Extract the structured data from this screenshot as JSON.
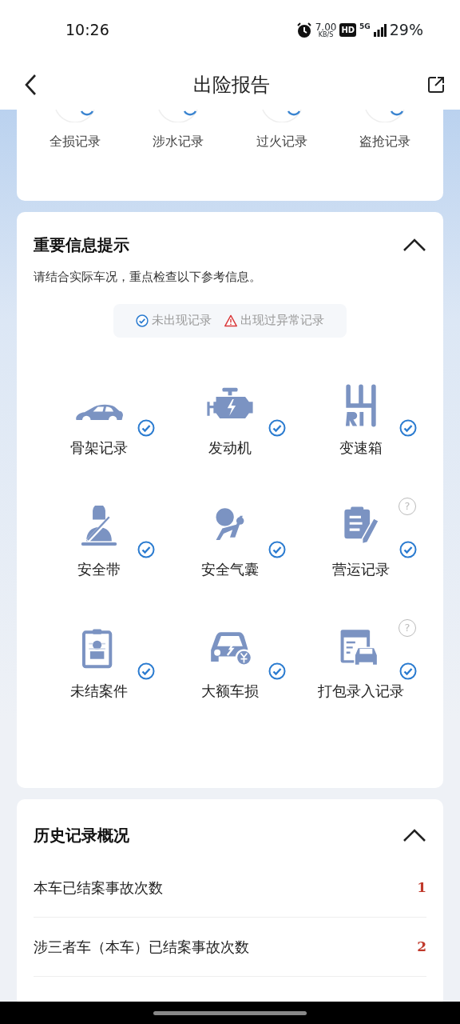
{
  "status_bar": {
    "time": "10:26",
    "net_speed": "7.00",
    "net_unit": "KB/S",
    "hd": "HD",
    "network": "5G",
    "battery": "29%"
  },
  "header": {
    "title": "出险报告"
  },
  "record_card": {
    "items": [
      {
        "label": "全损记录"
      },
      {
        "label": "涉水记录"
      },
      {
        "label": "过火记录"
      },
      {
        "label": "盗抢记录"
      }
    ]
  },
  "info_card": {
    "title": "重要信息提示",
    "expanded": true,
    "subtitle": "请结合实际车况，重点检查以下参考信息。",
    "legend": [
      {
        "kind": "ok",
        "label": "未出现记录"
      },
      {
        "kind": "abnormal",
        "label": "出现过异常记录"
      }
    ],
    "items": [
      {
        "label": "骨架记录",
        "kind": "ok"
      },
      {
        "label": "发动机",
        "kind": "ok"
      },
      {
        "label": "变速箱",
        "kind": "ok"
      },
      {
        "label": "安全带",
        "kind": "ok"
      },
      {
        "label": "安全气囊",
        "kind": "ok"
      },
      {
        "label": "营运记录",
        "kind": "ok",
        "help": "?"
      },
      {
        "label": "未结案件",
        "kind": "ok"
      },
      {
        "label": "大额车损",
        "kind": "ok"
      },
      {
        "label": "打包录入记录",
        "kind": "ok",
        "help": "?"
      }
    ]
  },
  "history_card": {
    "title": "历史记录概况",
    "expanded": true,
    "rows": [
      {
        "label": "本车已结案事故次数",
        "value": "1"
      },
      {
        "label": "涉三者车（本车）已结案事故次数",
        "value": "2"
      }
    ]
  }
}
